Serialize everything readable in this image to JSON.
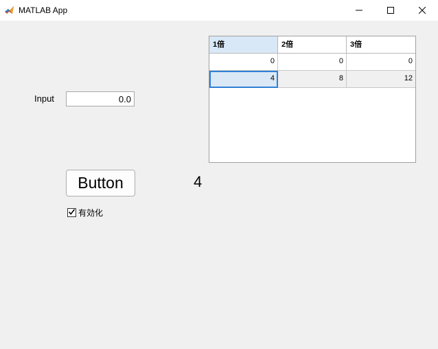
{
  "window": {
    "title": "MATLAB App",
    "icon": "matlab-icon",
    "controls": [
      "minimize-icon",
      "maximize-icon",
      "close-icon"
    ]
  },
  "input": {
    "label": "Input",
    "value": "0.0"
  },
  "table": {
    "columns": [
      "1倍",
      "2倍",
      "3倍"
    ],
    "rows": [
      [
        "0",
        "0",
        "0"
      ],
      [
        "4",
        "8",
        "12"
      ]
    ]
  },
  "button": {
    "label": "Button"
  },
  "result": {
    "value": "4"
  },
  "checkbox": {
    "label": "有効化",
    "checked": true
  }
}
